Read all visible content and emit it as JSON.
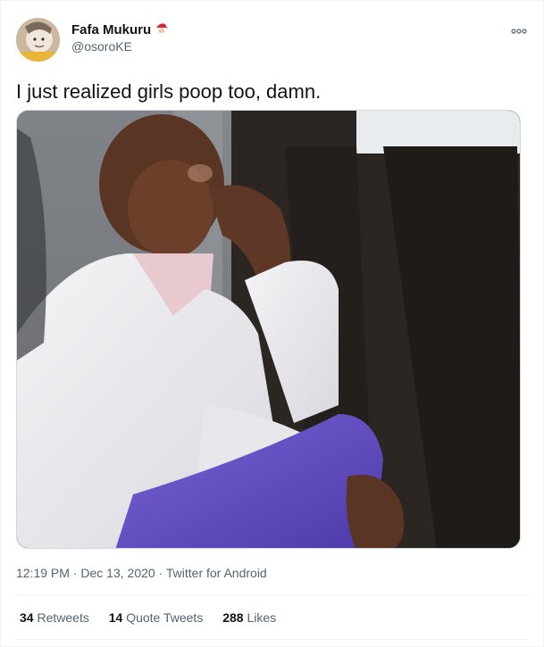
{
  "author": {
    "name": "Fafa Mukuru",
    "handle": "@osoroKE",
    "name_emoji": "santa-emoji"
  },
  "tweet": {
    "text": "I just realized girls poop too, damn.",
    "time": "12:19 PM",
    "date": "Dec 13, 2020",
    "source": "Twitter for Android",
    "separator": "·"
  },
  "stats": {
    "retweets_count": "34",
    "retweets_label": "Retweets",
    "quotes_count": "14",
    "quotes_label": "Quote Tweets",
    "likes_count": "288",
    "likes_label": "Likes"
  },
  "icons": {
    "more": "more-options-icon"
  },
  "colors": {
    "text_primary": "#0f1419",
    "text_secondary": "#536471",
    "divider": "#eff3f4"
  }
}
